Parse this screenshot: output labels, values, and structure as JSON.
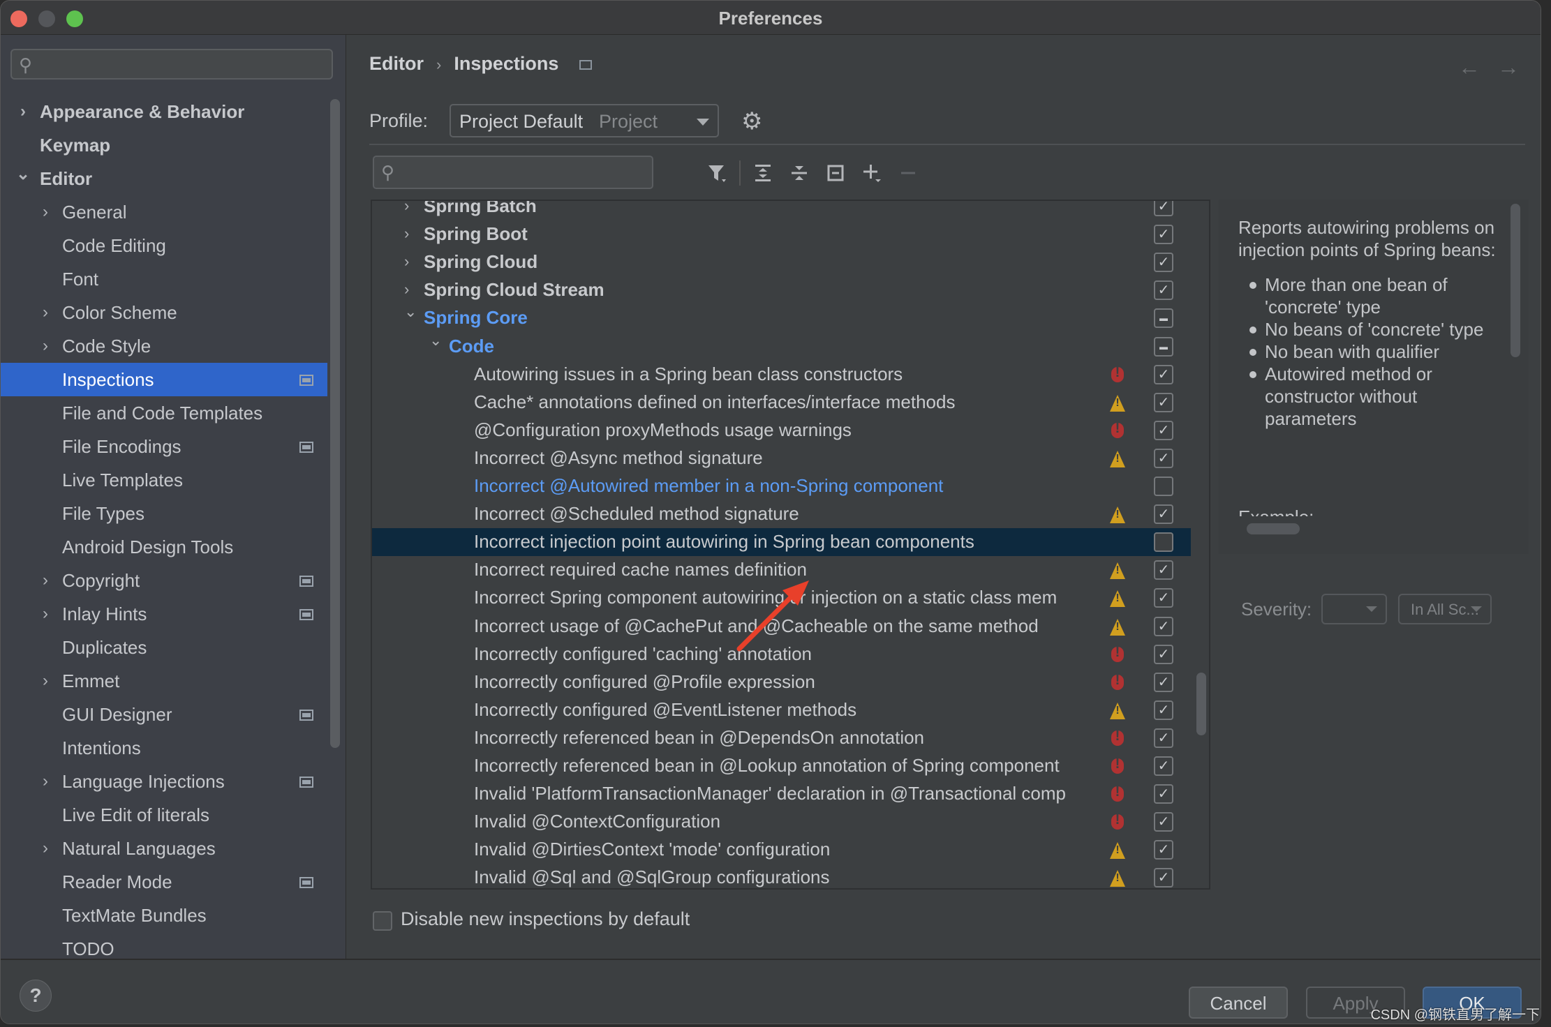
{
  "window": {
    "title": "Preferences"
  },
  "sidebar": {
    "search_placeholder": "",
    "items": [
      {
        "label": "Appearance & Behavior",
        "level": 0,
        "expandable": true,
        "expanded": false,
        "bold": true,
        "project_icon": false,
        "selected": false
      },
      {
        "label": "Keymap",
        "level": 0,
        "expandable": false,
        "bold": true,
        "project_icon": false,
        "selected": false
      },
      {
        "label": "Editor",
        "level": 0,
        "expandable": true,
        "expanded": true,
        "bold": true,
        "project_icon": false,
        "selected": false
      },
      {
        "label": "General",
        "level": 1,
        "expandable": true,
        "expanded": false,
        "project_icon": false,
        "selected": false
      },
      {
        "label": "Code Editing",
        "level": 1,
        "expandable": false,
        "project_icon": false,
        "selected": false
      },
      {
        "label": "Font",
        "level": 1,
        "expandable": false,
        "project_icon": false,
        "selected": false
      },
      {
        "label": "Color Scheme",
        "level": 1,
        "expandable": true,
        "expanded": false,
        "project_icon": false,
        "selected": false
      },
      {
        "label": "Code Style",
        "level": 1,
        "expandable": true,
        "expanded": false,
        "project_icon": false,
        "selected": false
      },
      {
        "label": "Inspections",
        "level": 1,
        "expandable": false,
        "project_icon": true,
        "selected": true
      },
      {
        "label": "File and Code Templates",
        "level": 1,
        "expandable": false,
        "project_icon": false,
        "selected": false
      },
      {
        "label": "File Encodings",
        "level": 1,
        "expandable": false,
        "project_icon": true,
        "selected": false
      },
      {
        "label": "Live Templates",
        "level": 1,
        "expandable": false,
        "project_icon": false,
        "selected": false
      },
      {
        "label": "File Types",
        "level": 1,
        "expandable": false,
        "project_icon": false,
        "selected": false
      },
      {
        "label": "Android Design Tools",
        "level": 1,
        "expandable": false,
        "project_icon": false,
        "selected": false
      },
      {
        "label": "Copyright",
        "level": 1,
        "expandable": true,
        "expanded": false,
        "project_icon": true,
        "selected": false
      },
      {
        "label": "Inlay Hints",
        "level": 1,
        "expandable": true,
        "expanded": false,
        "project_icon": true,
        "selected": false
      },
      {
        "label": "Duplicates",
        "level": 1,
        "expandable": false,
        "project_icon": false,
        "selected": false
      },
      {
        "label": "Emmet",
        "level": 1,
        "expandable": true,
        "expanded": false,
        "project_icon": false,
        "selected": false
      },
      {
        "label": "GUI Designer",
        "level": 1,
        "expandable": false,
        "project_icon": true,
        "selected": false
      },
      {
        "label": "Intentions",
        "level": 1,
        "expandable": false,
        "project_icon": false,
        "selected": false
      },
      {
        "label": "Language Injections",
        "level": 1,
        "expandable": true,
        "expanded": false,
        "project_icon": true,
        "selected": false
      },
      {
        "label": "Live Edit of literals",
        "level": 1,
        "expandable": false,
        "project_icon": false,
        "selected": false
      },
      {
        "label": "Natural Languages",
        "level": 1,
        "expandable": true,
        "expanded": false,
        "project_icon": false,
        "selected": false
      },
      {
        "label": "Reader Mode",
        "level": 1,
        "expandable": false,
        "project_icon": true,
        "selected": false
      },
      {
        "label": "TextMate Bundles",
        "level": 1,
        "expandable": false,
        "project_icon": false,
        "selected": false
      },
      {
        "label": "TODO",
        "level": 1,
        "expandable": false,
        "project_icon": false,
        "selected": false
      }
    ]
  },
  "header": {
    "breadcrumb": [
      "Editor",
      "Inspections"
    ],
    "breadcrumb_sep": "›",
    "back_icon": "←",
    "forward_icon": "→"
  },
  "profile": {
    "label": "Profile:",
    "value": "Project Default",
    "scope": "Project"
  },
  "toolbar": {
    "search_placeholder": "",
    "buttons": [
      "filter-icon",
      "expand-all-icon",
      "collapse-all-icon",
      "reset-icon",
      "add-icon",
      "remove-icon"
    ]
  },
  "tree": {
    "rows": [
      {
        "label": "Spring Batch",
        "type": "group",
        "level": 0,
        "expanded": false,
        "checkbox": "checked",
        "severity": null,
        "highlight": false,
        "selected": false
      },
      {
        "label": "Spring Boot",
        "type": "group",
        "level": 0,
        "expanded": false,
        "checkbox": "checked",
        "severity": null,
        "highlight": false,
        "selected": false
      },
      {
        "label": "Spring Cloud",
        "type": "group",
        "level": 0,
        "expanded": false,
        "checkbox": "checked",
        "severity": null,
        "highlight": false,
        "selected": false
      },
      {
        "label": "Spring Cloud Stream",
        "type": "group",
        "level": 0,
        "expanded": false,
        "checkbox": "checked",
        "severity": null,
        "highlight": false,
        "selected": false
      },
      {
        "label": "Spring Core",
        "type": "group",
        "level": 0,
        "expanded": true,
        "checkbox": "partial",
        "severity": null,
        "highlight": true,
        "selected": false
      },
      {
        "label": "Code",
        "type": "group",
        "level": 1,
        "expanded": true,
        "checkbox": "partial",
        "severity": null,
        "highlight": true,
        "selected": false
      },
      {
        "label": "Autowiring issues in a Spring bean class constructors",
        "type": "item",
        "level": 2,
        "checkbox": "checked",
        "severity": "error",
        "highlight": false,
        "selected": false
      },
      {
        "label": "Cache* annotations defined on interfaces/interface methods",
        "type": "item",
        "level": 2,
        "checkbox": "checked",
        "severity": "warning",
        "highlight": false,
        "selected": false
      },
      {
        "label": "@Configuration proxyMethods usage warnings",
        "type": "item",
        "level": 2,
        "checkbox": "checked",
        "severity": "error",
        "highlight": false,
        "selected": false
      },
      {
        "label": "Incorrect @Async method signature",
        "type": "item",
        "level": 2,
        "checkbox": "checked",
        "severity": "warning",
        "highlight": false,
        "selected": false
      },
      {
        "label": "Incorrect @Autowired member in a non-Spring component",
        "type": "item",
        "level": 2,
        "checkbox": "unchecked",
        "severity": null,
        "highlight": true,
        "selected": false
      },
      {
        "label": "Incorrect @Scheduled method signature",
        "type": "item",
        "level": 2,
        "checkbox": "checked",
        "severity": "warning",
        "highlight": false,
        "selected": false
      },
      {
        "label": "Incorrect injection point autowiring in Spring bean components",
        "type": "item",
        "level": 2,
        "checkbox": "unchecked",
        "severity": null,
        "highlight": false,
        "selected": true
      },
      {
        "label": "Incorrect required cache names definition",
        "type": "item",
        "level": 2,
        "checkbox": "checked",
        "severity": "warning",
        "highlight": false,
        "selected": false
      },
      {
        "label": "Incorrect Spring component autowiring or injection on a static class mem",
        "type": "item",
        "level": 2,
        "checkbox": "checked",
        "severity": "warning",
        "highlight": false,
        "selected": false
      },
      {
        "label": "Incorrect usage of @CachePut and @Cacheable on the same method",
        "type": "item",
        "level": 2,
        "checkbox": "checked",
        "severity": "warning",
        "highlight": false,
        "selected": false
      },
      {
        "label": "Incorrectly configured 'caching' annotation",
        "type": "item",
        "level": 2,
        "checkbox": "checked",
        "severity": "error",
        "highlight": false,
        "selected": false
      },
      {
        "label": "Incorrectly configured @Profile expression",
        "type": "item",
        "level": 2,
        "checkbox": "checked",
        "severity": "error",
        "highlight": false,
        "selected": false
      },
      {
        "label": "Incorrectly configured  @EventListener methods",
        "type": "item",
        "level": 2,
        "checkbox": "checked",
        "severity": "warning",
        "highlight": false,
        "selected": false
      },
      {
        "label": "Incorrectly referenced bean in @DependsOn annotation",
        "type": "item",
        "level": 2,
        "checkbox": "checked",
        "severity": "error",
        "highlight": false,
        "selected": false
      },
      {
        "label": "Incorrectly referenced bean in @Lookup annotation of Spring component",
        "type": "item",
        "level": 2,
        "checkbox": "checked",
        "severity": "error",
        "highlight": false,
        "selected": false
      },
      {
        "label": "Invalid 'PlatformTransactionManager' declaration in @Transactional comp",
        "type": "item",
        "level": 2,
        "checkbox": "checked",
        "severity": "error",
        "highlight": false,
        "selected": false
      },
      {
        "label": "Invalid @ContextConfiguration",
        "type": "item",
        "level": 2,
        "checkbox": "checked",
        "severity": "error",
        "highlight": false,
        "selected": false
      },
      {
        "label": "Invalid @DirtiesContext 'mode' configuration",
        "type": "item",
        "level": 2,
        "checkbox": "checked",
        "severity": "warning",
        "highlight": false,
        "selected": false
      },
      {
        "label": "Invalid @Sql and @SqlGroup configurations",
        "type": "item",
        "level": 2,
        "checkbox": "checked",
        "severity": "warning",
        "highlight": false,
        "selected": false
      }
    ]
  },
  "description": {
    "intro": "Reports autowiring problems on injection points of Spring beans:",
    "bullets": [
      "More than one bean of 'concrete' type",
      "No beans of 'concrete' type",
      "No bean with qualifier",
      "Autowired method or constructor without parameters"
    ],
    "cut_heading": "Example:"
  },
  "severity": {
    "label": "Severity:",
    "value": "",
    "scope_value": "In All Sc..."
  },
  "options": {
    "disable_new_label": "Disable new inspections by default",
    "disable_new_checked": false
  },
  "footer": {
    "help": "?",
    "cancel": "Cancel",
    "apply": "Apply",
    "ok": "OK"
  },
  "watermark": "CSDN @钢铁直男了解一下",
  "colors": {
    "accent": "#2f65ca",
    "selected_row": "#0d293e",
    "link_blue": "#5c9cf5",
    "error": "#b13232",
    "warning": "#d19f1f",
    "annotation_arrow": "#e8402a"
  }
}
